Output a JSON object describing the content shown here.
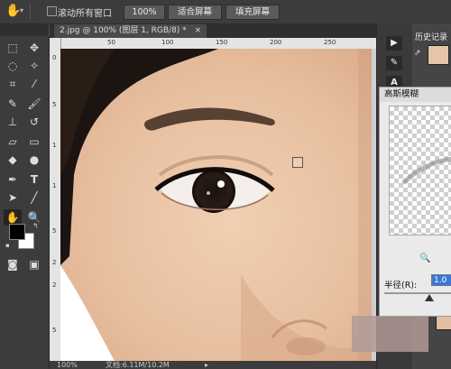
{
  "options_bar": {
    "scroll_all_windows_label": "滚动所有窗口",
    "zoom_100_label": "100%",
    "fit_screen_label": "适合屏幕",
    "fill_screen_label": "填充屏幕"
  },
  "document": {
    "tab_title": "2.jpg @ 100% (图层 1, RGB/8) *",
    "close_glyph": "×"
  },
  "ruler": {
    "top_ticks": [
      "0",
      "50",
      "100",
      "150",
      "200",
      "250"
    ],
    "left_ticks": [
      "0",
      "5",
      "1",
      "1",
      "5",
      "2",
      "2",
      "5"
    ]
  },
  "status_bar": {
    "zoom": "100%",
    "doc_size": "文档:6.11M/10.2M"
  },
  "right_panel": {
    "history_tab_label": "历史记录"
  },
  "gaussian_dialog": {
    "title": "高斯模糊",
    "radius_label": "半径(R):",
    "radius_value": "1.0",
    "zoom_glyph": "🔍"
  },
  "colors": {
    "ui_dark": "#3c3c3c",
    "accent": "#3a78d8"
  }
}
